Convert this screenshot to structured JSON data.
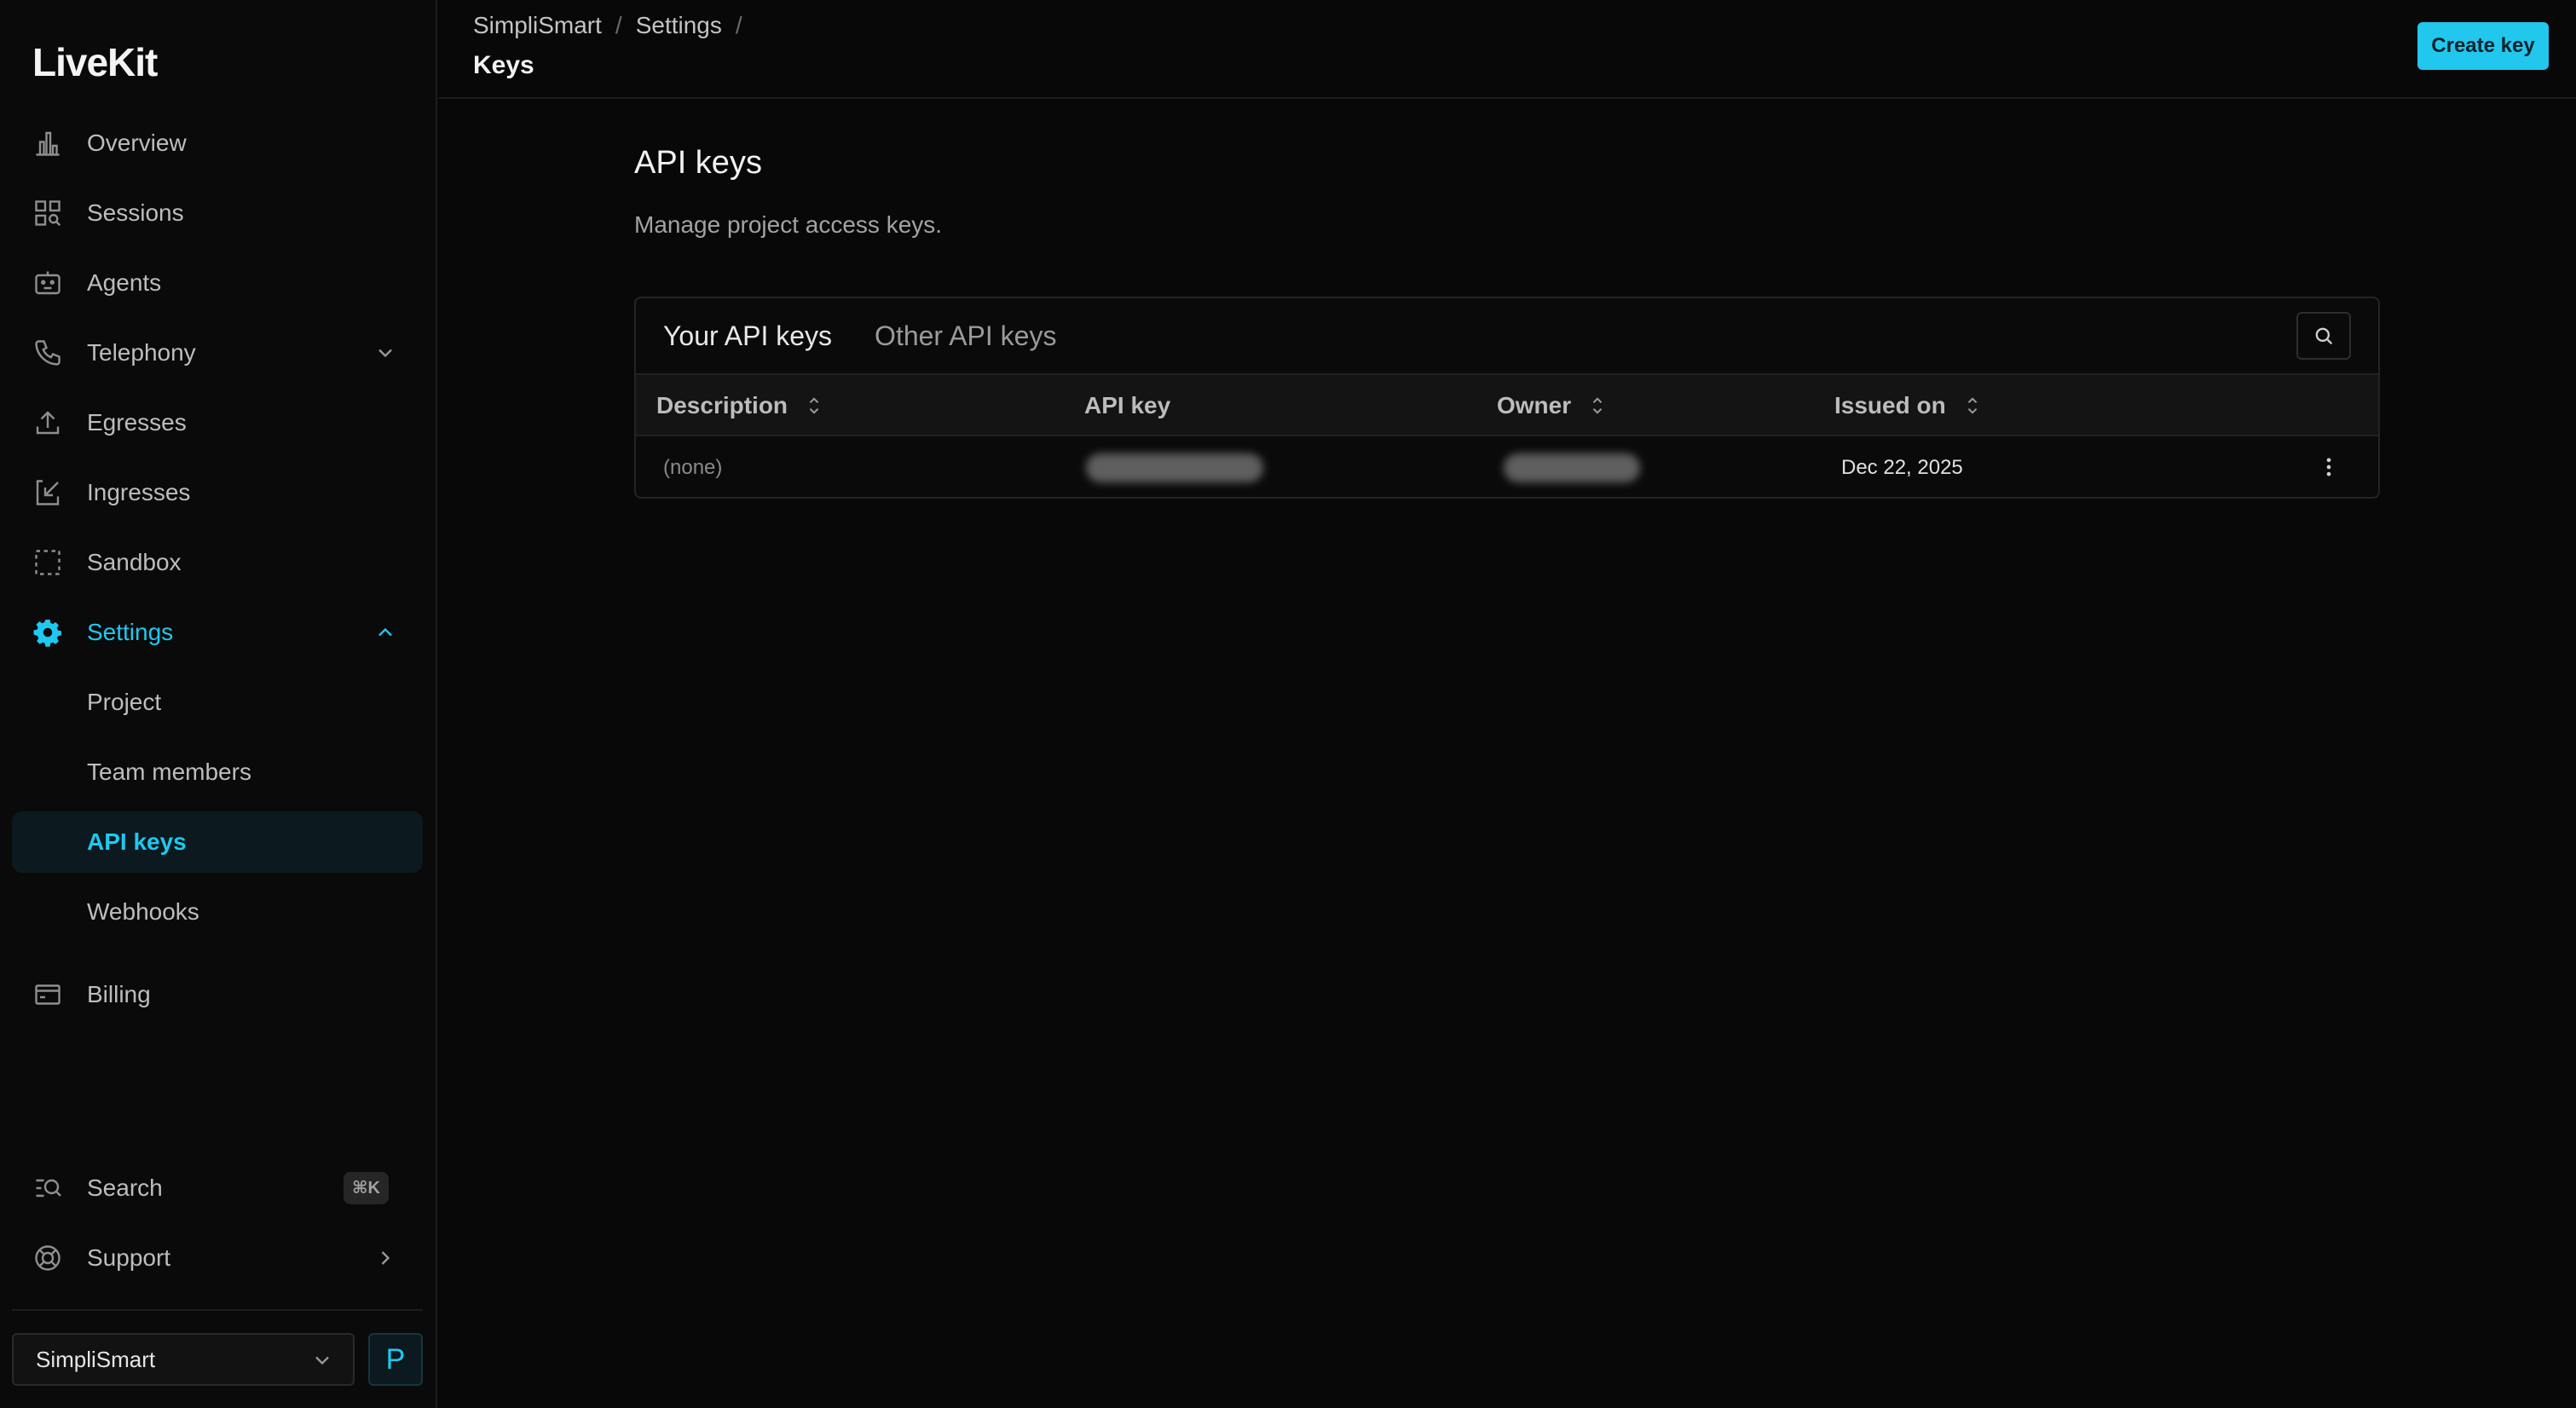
{
  "sidebar": {
    "logo": "LiveKit",
    "nav": {
      "overview": "Overview",
      "sessions": "Sessions",
      "agents": "Agents",
      "telephony": "Telephony",
      "egresses": "Egresses",
      "ingresses": "Ingresses",
      "sandbox": "Sandbox",
      "settings": "Settings",
      "billing": "Billing"
    },
    "settings_sub": {
      "project": "Project",
      "team_members": "Team members",
      "api_keys": "API keys",
      "webhooks": "Webhooks"
    },
    "search": {
      "label": "Search",
      "shortcut": "⌘K"
    },
    "support": "Support",
    "project_selector": "SimpliSmart",
    "avatar_initial": "P",
    "accent_color": "#1fc8f0"
  },
  "header": {
    "breadcrumb": [
      "SimpliSmart",
      "Settings"
    ],
    "page_title": "Keys",
    "create_button": "Create key"
  },
  "main": {
    "title": "API keys",
    "subtitle": "Manage project access keys.",
    "tabs": [
      "Your API keys",
      "Other API keys"
    ],
    "active_tab": "Your API keys",
    "columns": {
      "description": "Description",
      "api_key": "API key",
      "owner": "Owner",
      "issued_on": "Issued on"
    },
    "rows": [
      {
        "description": "(none)",
        "api_key": "",
        "owner": "",
        "issued_on": "Dec 22, 2025"
      }
    ]
  }
}
